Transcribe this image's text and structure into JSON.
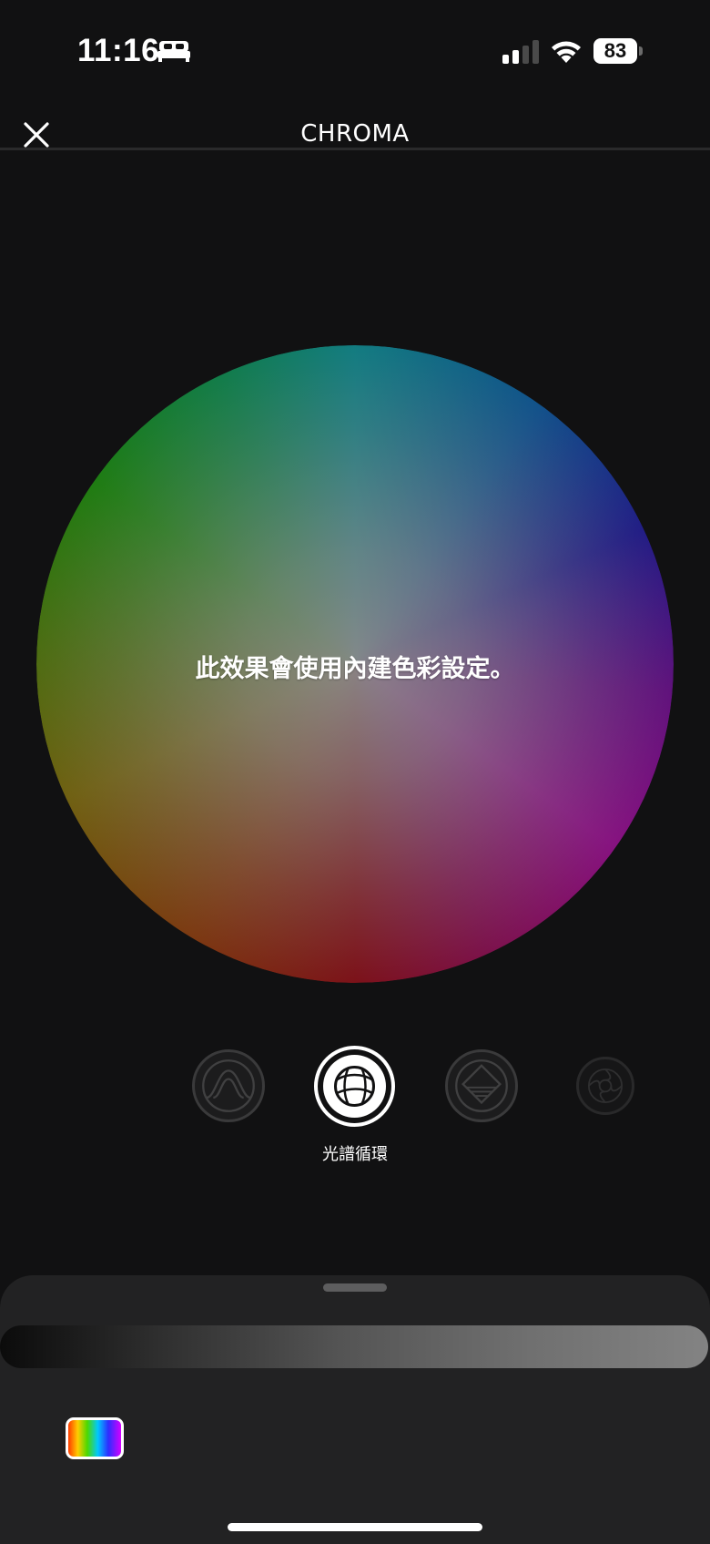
{
  "status_bar": {
    "time": "11:16",
    "focus_icon": "bed-icon",
    "signal_icon": "cellular-signal-icon",
    "wifi_icon": "wifi-icon",
    "battery_percent": "83"
  },
  "header": {
    "title": "CHROMA",
    "close_icon": "close-icon"
  },
  "color_wheel": {
    "message": "此效果會使用內建色彩設定。"
  },
  "effects": {
    "items": [
      {
        "icon": "breathing-effect-icon",
        "selected": false
      },
      {
        "icon": "spectrum-cycling-effect-icon",
        "selected": true
      },
      {
        "icon": "static-effect-icon",
        "selected": false
      },
      {
        "icon": "wave-effect-icon",
        "selected": false
      }
    ],
    "selected_label": "光譜循環"
  },
  "bottom_sheet": {
    "brightness_icon": "brightness-gradient-slider",
    "palette_icon": "rainbow-palette-icon"
  },
  "colors": {
    "background": "#111112",
    "sheet": "#222223",
    "accent": "#ffffff"
  }
}
